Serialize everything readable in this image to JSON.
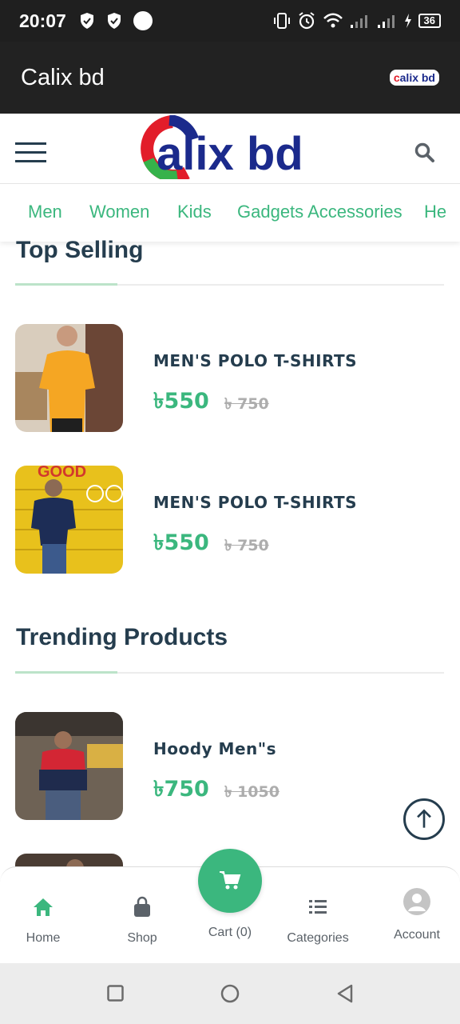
{
  "status_bar": {
    "time": "20:07",
    "battery": "36"
  },
  "app_bar": {
    "title": "Calix bd",
    "mini_logo": "alix bd",
    "mini_logo_c": "c"
  },
  "header": {
    "logo_letter_c": "c",
    "logo_text": "alix bd"
  },
  "categories": [
    "Men",
    "Women",
    "Kids",
    "Gadgets Accessories",
    "He"
  ],
  "top_selling": {
    "title": "Top Selling",
    "products": [
      {
        "name": "MEN'S POLO T-SHIRTS",
        "price": "৳550",
        "old_price": "৳ 750"
      },
      {
        "name": "MEN'S POLO T-SHIRTS",
        "price": "৳550",
        "old_price": "৳ 750"
      }
    ]
  },
  "trending": {
    "title": "Trending Products",
    "products": [
      {
        "name": "Hoody Men\"s",
        "price": "৳750",
        "old_price": "৳ 1050"
      }
    ]
  },
  "bottom_nav": {
    "home": "Home",
    "shop": "Shop",
    "cart": "Cart (0)",
    "categories": "Categories",
    "account": "Account"
  },
  "colors": {
    "accent": "#3bb77e",
    "heading": "#253d4e",
    "muted": "#adadad",
    "brand_blue": "#1b2a8c",
    "brand_red": "#e21d2a"
  }
}
